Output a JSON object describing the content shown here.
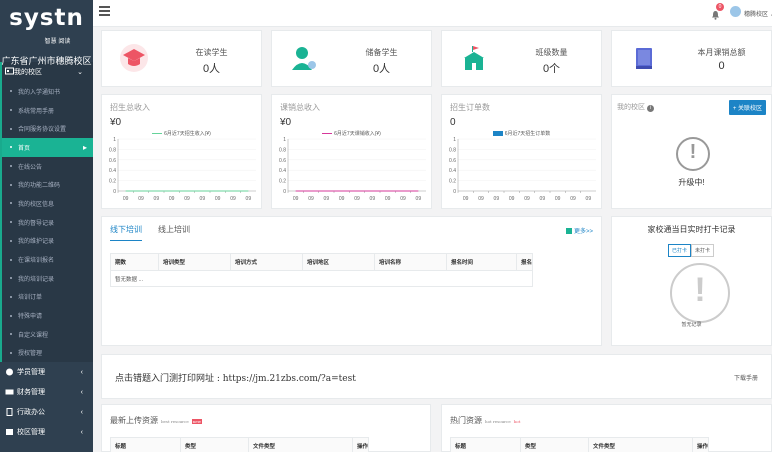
{
  "logo": {
    "main": "systn",
    "sub": "智慧 阅读",
    "school": "广东省广州市穗腾校区"
  },
  "sidebar": {
    "group_label": "我的校区",
    "sub_items": [
      {
        "label": "我的入学通知书"
      },
      {
        "label": "系统常用手册"
      },
      {
        "label": "合同服务协议设置"
      },
      {
        "label": "首页"
      },
      {
        "label": "在线公告"
      },
      {
        "label": "我的功能二维码"
      },
      {
        "label": "我的校区信息"
      },
      {
        "label": "我的督导记录"
      },
      {
        "label": "我的维护记录"
      },
      {
        "label": "在课培训报名"
      },
      {
        "label": "我的培训记录"
      },
      {
        "label": "培训订单"
      },
      {
        "label": "特殊申请"
      },
      {
        "label": "自定义课程"
      },
      {
        "label": "授权管理"
      }
    ],
    "sections": [
      {
        "label": "学员管理"
      },
      {
        "label": "财务管理"
      },
      {
        "label": "行政办公"
      },
      {
        "label": "校区管理"
      }
    ]
  },
  "topbar": {
    "badge": "0",
    "user": "穗腾校区"
  },
  "stats": [
    {
      "label": "在读学生",
      "value": "0人",
      "color": "#ed5565"
    },
    {
      "label": "储备学生",
      "value": "0人",
      "color": "#1ab394"
    },
    {
      "label": "班级数量",
      "value": "0个",
      "color": "#1ab394"
    },
    {
      "label": "本月课销总额",
      "value": "0",
      "color": "#5b6bd6"
    }
  ],
  "chart_data": [
    {
      "type": "line",
      "title": "招生总收入",
      "value": "¥0",
      "legend": "6月近7天招生收入(¥)",
      "color": "#65d39a",
      "x": [
        "09",
        "09",
        "09",
        "09",
        "09",
        "09",
        "09",
        "09",
        "09"
      ],
      "yticks": [
        "1",
        "0.8",
        "0.6",
        "0.4",
        "0.2",
        "0"
      ],
      "ylim": [
        0,
        1
      ]
    },
    {
      "type": "line",
      "title": "课销总收入",
      "value": "¥0",
      "legend": "6月近7天课销收入(¥)",
      "color": "#d6379a",
      "x": [
        "09",
        "09",
        "09",
        "09",
        "09",
        "09",
        "09",
        "09",
        "09"
      ],
      "yticks": [
        "1",
        "0.8",
        "0.6",
        "0.4",
        "0.2",
        "0"
      ],
      "ylim": [
        0,
        1
      ]
    },
    {
      "type": "bar",
      "title": "招生订单数",
      "value": "0",
      "legend": "6月近7天招生订单数",
      "color": "#1c84c6",
      "x": [
        "09",
        "09",
        "09",
        "09",
        "09",
        "09",
        "09",
        "09",
        "09"
      ],
      "yticks": [
        "1",
        "0.8",
        "0.6",
        "0.4",
        "0.2",
        "0"
      ],
      "ylim": [
        0,
        1
      ]
    }
  ],
  "my_school": {
    "title": "我的校区",
    "button": "+ 关联校区",
    "status": "升级中!"
  },
  "training": {
    "tabs": [
      "线下培训",
      "线上培训"
    ],
    "more": "更多>>",
    "columns": [
      "期数",
      "培训类型",
      "培训方式",
      "培训地区",
      "培训名称",
      "报名时间",
      "报名"
    ],
    "empty": "暂无数据 ..."
  },
  "checkin": {
    "title": "家校通当日实时打卡记录",
    "buttons": [
      "已打卡",
      "未打卡"
    ],
    "empty": "暂无记录"
  },
  "print": {
    "text": "点击错题入门测打印网址 : https://jm.21zbs.com/?a=test",
    "link": "下载手册"
  },
  "resources": {
    "latest": {
      "title": "最新上传资源",
      "tag": "best resource",
      "badge": "new",
      "columns": [
        "标题",
        "类型",
        "文件类型",
        "操作"
      ]
    },
    "hot": {
      "title": "热门资源",
      "tag": "hot resource",
      "badge": "hot",
      "columns": [
        "标题",
        "类型",
        "文件类型",
        "操作"
      ]
    }
  }
}
